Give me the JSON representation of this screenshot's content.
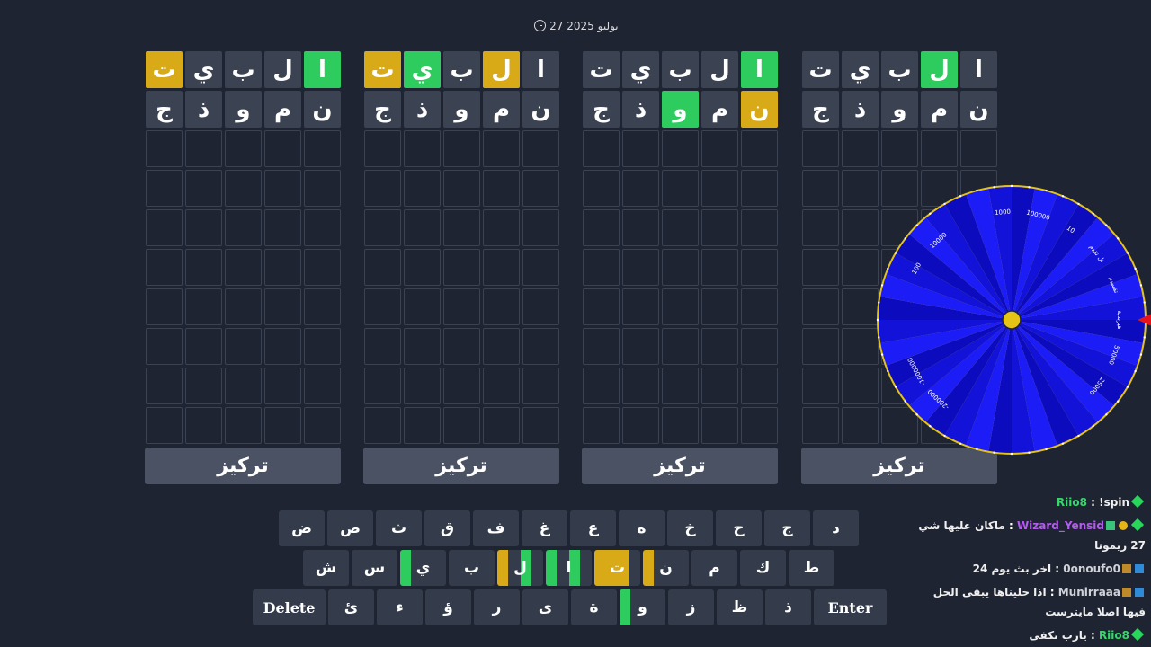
{
  "date": {
    "text": "27 يوليو 2025"
  },
  "boards": [
    {
      "rows": [
        [
          {
            "l": "ا",
            "s": "f"
          },
          {
            "l": "ل",
            "s": "g"
          },
          {
            "l": "ب",
            "s": "f"
          },
          {
            "l": "ي",
            "s": "f"
          },
          {
            "l": "ت",
            "s": "f"
          }
        ],
        [
          {
            "l": "ن",
            "s": "f"
          },
          {
            "l": "م",
            "s": "f"
          },
          {
            "l": "و",
            "s": "f"
          },
          {
            "l": "ذ",
            "s": "f"
          },
          {
            "l": "ج",
            "s": "f"
          }
        ]
      ],
      "focus_label": "تركيز"
    },
    {
      "rows": [
        [
          {
            "l": "ا",
            "s": "g"
          },
          {
            "l": "ل",
            "s": "f"
          },
          {
            "l": "ب",
            "s": "f"
          },
          {
            "l": "ي",
            "s": "f"
          },
          {
            "l": "ت",
            "s": "f"
          }
        ],
        [
          {
            "l": "ن",
            "s": "y"
          },
          {
            "l": "م",
            "s": "f"
          },
          {
            "l": "و",
            "s": "g"
          },
          {
            "l": "ذ",
            "s": "f"
          },
          {
            "l": "ج",
            "s": "f"
          }
        ]
      ],
      "focus_label": "تركيز"
    },
    {
      "rows": [
        [
          {
            "l": "ا",
            "s": "f"
          },
          {
            "l": "ل",
            "s": "y"
          },
          {
            "l": "ب",
            "s": "f"
          },
          {
            "l": "ي",
            "s": "g"
          },
          {
            "l": "ت",
            "s": "y"
          }
        ],
        [
          {
            "l": "ن",
            "s": "f"
          },
          {
            "l": "م",
            "s": "f"
          },
          {
            "l": "و",
            "s": "f"
          },
          {
            "l": "ذ",
            "s": "f"
          },
          {
            "l": "ج",
            "s": "f"
          }
        ]
      ],
      "focus_label": "تركيز"
    },
    {
      "rows": [
        [
          {
            "l": "ا",
            "s": "g"
          },
          {
            "l": "ل",
            "s": "f"
          },
          {
            "l": "ب",
            "s": "f"
          },
          {
            "l": "ي",
            "s": "f"
          },
          {
            "l": "ت",
            "s": "y"
          }
        ],
        [
          {
            "l": "ن",
            "s": "f"
          },
          {
            "l": "م",
            "s": "f"
          },
          {
            "l": "و",
            "s": "f"
          },
          {
            "l": "ذ",
            "s": "f"
          },
          {
            "l": "ج",
            "s": "f"
          }
        ]
      ],
      "focus_label": "تركيز"
    }
  ],
  "keyboard": {
    "row1": [
      {
        "k": "د"
      },
      {
        "k": "ج"
      },
      {
        "k": "ح"
      },
      {
        "k": "خ"
      },
      {
        "k": "ه"
      },
      {
        "k": "ع"
      },
      {
        "k": "غ"
      },
      {
        "k": "ف"
      },
      {
        "k": "ق"
      },
      {
        "k": "ث"
      },
      {
        "k": "ص"
      },
      {
        "k": "ض"
      }
    ],
    "row2": [
      {
        "k": "ط"
      },
      {
        "k": "ك"
      },
      {
        "k": "م"
      },
      {
        "k": "ن",
        "bars": [
          "y"
        ]
      },
      {
        "k": "ت",
        "bars": [
          "y",
          "y"
        ]
      },
      {
        "k": "ا",
        "bars": [
          "g",
          "g"
        ]
      },
      {
        "k": "ل",
        "bars": [
          "y",
          "g"
        ]
      },
      {
        "k": "ب"
      },
      {
        "k": "ي",
        "bars": [
          "g"
        ]
      },
      {
        "k": "س"
      },
      {
        "k": "ش"
      }
    ],
    "row3": [
      {
        "k": "Enter",
        "wide": true
      },
      {
        "k": "ذ"
      },
      {
        "k": "ظ"
      },
      {
        "k": "ز"
      },
      {
        "k": "و",
        "bars": [
          "g"
        ]
      },
      {
        "k": "ة"
      },
      {
        "k": "ى"
      },
      {
        "k": "ر"
      },
      {
        "k": "ؤ"
      },
      {
        "k": "ء"
      },
      {
        "k": "ئ"
      },
      {
        "k": "Delete",
        "wide": true
      }
    ]
  },
  "wheel": {
    "segments": [
      "هيربدية",
      "50000",
      "25000",
      "",
      "",
      "",
      "",
      "-200000",
      "-1000000",
      "",
      "",
      "100",
      "10000",
      "",
      "1000",
      "100000",
      "10",
      "تل تقدم",
      "تقسيم"
    ],
    "colors": {
      "ring": "#e4c21c",
      "dark": "#0c0cbe",
      "light": "#1c1cf6",
      "hub": "#e5c416",
      "pointer": "#e8121a"
    }
  },
  "chat": [
    {
      "user": "Riio8",
      "user_color": "#38d66b",
      "message": "!spin",
      "badges": [
        "gem"
      ]
    },
    {
      "user": "Wizard_Yensid",
      "user_color": "#b45cf0",
      "message": "ماكان عليها شي 27 ريمونا",
      "badges": [
        "gem",
        "gold",
        "sub"
      ]
    },
    {
      "user": "0onoufo0",
      "user_color": "#cfd2d8",
      "message": "اخر بث يوم 24",
      "badges": [
        "mod",
        "sub2"
      ]
    },
    {
      "user": "Munirraaa",
      "user_color": "#cfd2d8",
      "message": "اذا حليناها يبقى الحل فيها اصلا مايترست",
      "badges": [
        "mod",
        "sub2"
      ]
    },
    {
      "user": "Riio8",
      "user_color": "#38d66b",
      "message": "يارب تكفى",
      "badges": [
        "gem"
      ]
    }
  ]
}
